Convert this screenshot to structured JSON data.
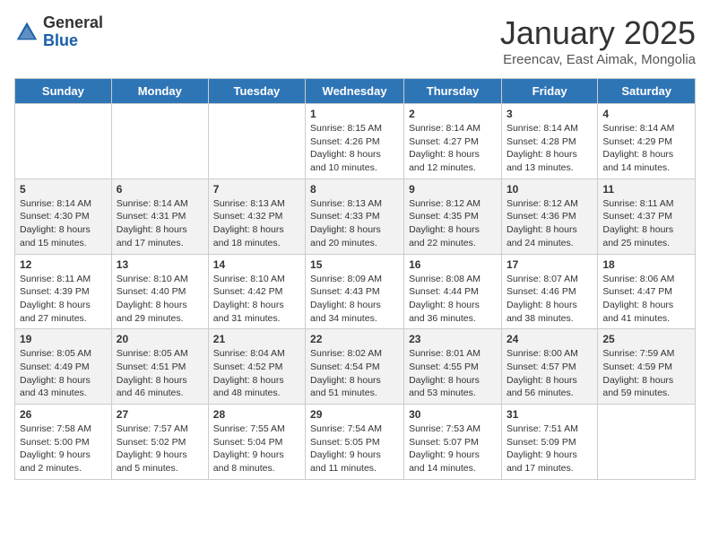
{
  "header": {
    "logo_general": "General",
    "logo_blue": "Blue",
    "month_title": "January 2025",
    "location": "Ereencav, East Aimak, Mongolia"
  },
  "days_of_week": [
    "Sunday",
    "Monday",
    "Tuesday",
    "Wednesday",
    "Thursday",
    "Friday",
    "Saturday"
  ],
  "weeks": [
    [
      {
        "day": "",
        "info": ""
      },
      {
        "day": "",
        "info": ""
      },
      {
        "day": "",
        "info": ""
      },
      {
        "day": "1",
        "info": "Sunrise: 8:15 AM\nSunset: 4:26 PM\nDaylight: 8 hours\nand 10 minutes."
      },
      {
        "day": "2",
        "info": "Sunrise: 8:14 AM\nSunset: 4:27 PM\nDaylight: 8 hours\nand 12 minutes."
      },
      {
        "day": "3",
        "info": "Sunrise: 8:14 AM\nSunset: 4:28 PM\nDaylight: 8 hours\nand 13 minutes."
      },
      {
        "day": "4",
        "info": "Sunrise: 8:14 AM\nSunset: 4:29 PM\nDaylight: 8 hours\nand 14 minutes."
      }
    ],
    [
      {
        "day": "5",
        "info": "Sunrise: 8:14 AM\nSunset: 4:30 PM\nDaylight: 8 hours\nand 15 minutes."
      },
      {
        "day": "6",
        "info": "Sunrise: 8:14 AM\nSunset: 4:31 PM\nDaylight: 8 hours\nand 17 minutes."
      },
      {
        "day": "7",
        "info": "Sunrise: 8:13 AM\nSunset: 4:32 PM\nDaylight: 8 hours\nand 18 minutes."
      },
      {
        "day": "8",
        "info": "Sunrise: 8:13 AM\nSunset: 4:33 PM\nDaylight: 8 hours\nand 20 minutes."
      },
      {
        "day": "9",
        "info": "Sunrise: 8:12 AM\nSunset: 4:35 PM\nDaylight: 8 hours\nand 22 minutes."
      },
      {
        "day": "10",
        "info": "Sunrise: 8:12 AM\nSunset: 4:36 PM\nDaylight: 8 hours\nand 24 minutes."
      },
      {
        "day": "11",
        "info": "Sunrise: 8:11 AM\nSunset: 4:37 PM\nDaylight: 8 hours\nand 25 minutes."
      }
    ],
    [
      {
        "day": "12",
        "info": "Sunrise: 8:11 AM\nSunset: 4:39 PM\nDaylight: 8 hours\nand 27 minutes."
      },
      {
        "day": "13",
        "info": "Sunrise: 8:10 AM\nSunset: 4:40 PM\nDaylight: 8 hours\nand 29 minutes."
      },
      {
        "day": "14",
        "info": "Sunrise: 8:10 AM\nSunset: 4:42 PM\nDaylight: 8 hours\nand 31 minutes."
      },
      {
        "day": "15",
        "info": "Sunrise: 8:09 AM\nSunset: 4:43 PM\nDaylight: 8 hours\nand 34 minutes."
      },
      {
        "day": "16",
        "info": "Sunrise: 8:08 AM\nSunset: 4:44 PM\nDaylight: 8 hours\nand 36 minutes."
      },
      {
        "day": "17",
        "info": "Sunrise: 8:07 AM\nSunset: 4:46 PM\nDaylight: 8 hours\nand 38 minutes."
      },
      {
        "day": "18",
        "info": "Sunrise: 8:06 AM\nSunset: 4:47 PM\nDaylight: 8 hours\nand 41 minutes."
      }
    ],
    [
      {
        "day": "19",
        "info": "Sunrise: 8:05 AM\nSunset: 4:49 PM\nDaylight: 8 hours\nand 43 minutes."
      },
      {
        "day": "20",
        "info": "Sunrise: 8:05 AM\nSunset: 4:51 PM\nDaylight: 8 hours\nand 46 minutes."
      },
      {
        "day": "21",
        "info": "Sunrise: 8:04 AM\nSunset: 4:52 PM\nDaylight: 8 hours\nand 48 minutes."
      },
      {
        "day": "22",
        "info": "Sunrise: 8:02 AM\nSunset: 4:54 PM\nDaylight: 8 hours\nand 51 minutes."
      },
      {
        "day": "23",
        "info": "Sunrise: 8:01 AM\nSunset: 4:55 PM\nDaylight: 8 hours\nand 53 minutes."
      },
      {
        "day": "24",
        "info": "Sunrise: 8:00 AM\nSunset: 4:57 PM\nDaylight: 8 hours\nand 56 minutes."
      },
      {
        "day": "25",
        "info": "Sunrise: 7:59 AM\nSunset: 4:59 PM\nDaylight: 8 hours\nand 59 minutes."
      }
    ],
    [
      {
        "day": "26",
        "info": "Sunrise: 7:58 AM\nSunset: 5:00 PM\nDaylight: 9 hours\nand 2 minutes."
      },
      {
        "day": "27",
        "info": "Sunrise: 7:57 AM\nSunset: 5:02 PM\nDaylight: 9 hours\nand 5 minutes."
      },
      {
        "day": "28",
        "info": "Sunrise: 7:55 AM\nSunset: 5:04 PM\nDaylight: 9 hours\nand 8 minutes."
      },
      {
        "day": "29",
        "info": "Sunrise: 7:54 AM\nSunset: 5:05 PM\nDaylight: 9 hours\nand 11 minutes."
      },
      {
        "day": "30",
        "info": "Sunrise: 7:53 AM\nSunset: 5:07 PM\nDaylight: 9 hours\nand 14 minutes."
      },
      {
        "day": "31",
        "info": "Sunrise: 7:51 AM\nSunset: 5:09 PM\nDaylight: 9 hours\nand 17 minutes."
      },
      {
        "day": "",
        "info": ""
      }
    ]
  ]
}
